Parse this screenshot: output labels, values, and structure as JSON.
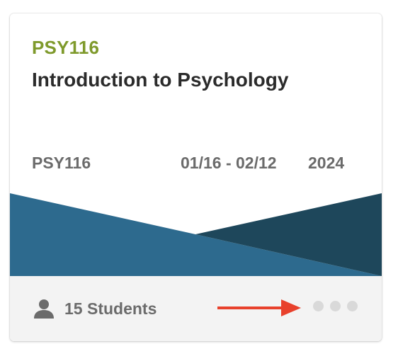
{
  "course": {
    "code_heading": "PSY116",
    "title": "Introduction to Psychology",
    "code": "PSY116",
    "dates": "01/16 - 02/12",
    "year": "2024"
  },
  "footer": {
    "students_label": "15 Students",
    "user_icon": "user-icon",
    "more_icon": "more-options-icon"
  },
  "colors": {
    "code_accent": "#7f9a2c",
    "banner_light": "#2d6a8e",
    "banner_dark": "#1e475b",
    "annotation_arrow": "#e8412c"
  }
}
